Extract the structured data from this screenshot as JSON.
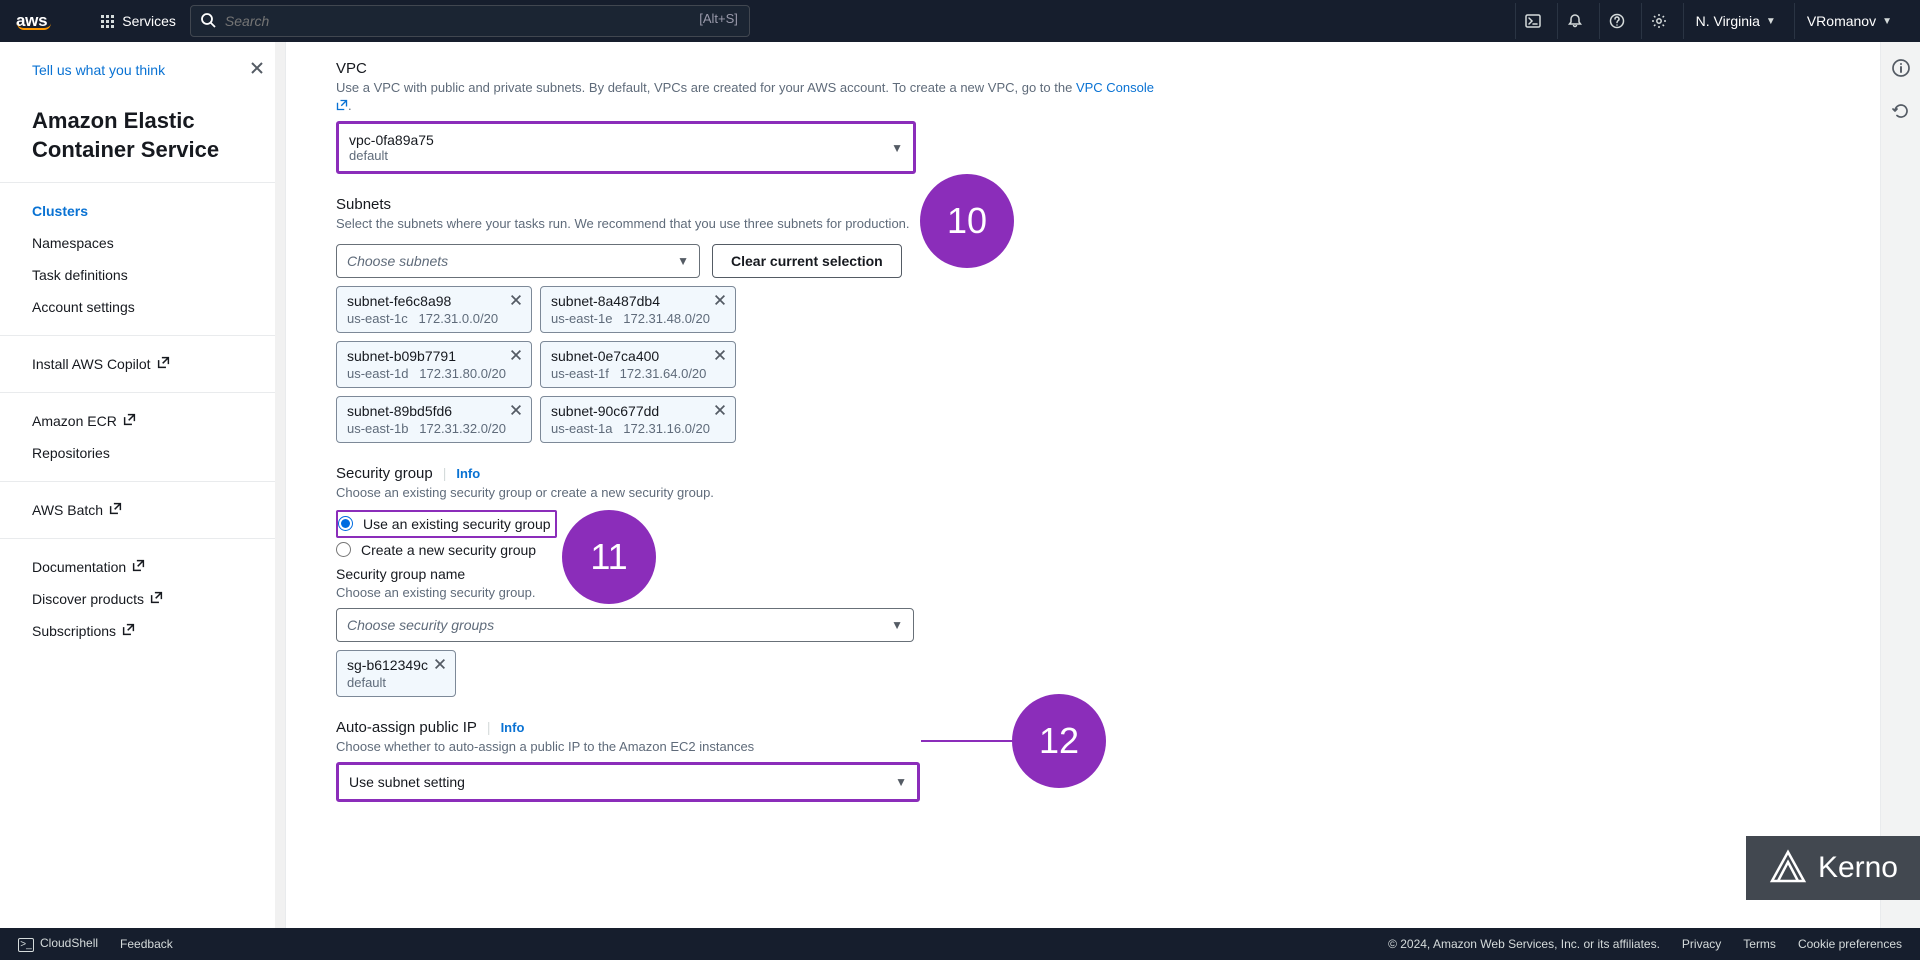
{
  "topnav": {
    "logo_alt": "aws",
    "services_label": "Services",
    "search_placeholder": "Search",
    "search_shortcut": "[Alt+S]",
    "region": "N. Virginia",
    "user": "VRomanov"
  },
  "sidebar": {
    "feedback": "Tell us what you think",
    "title": "Amazon Elastic Container Service",
    "items": [
      {
        "label": "Clusters",
        "active": true
      },
      {
        "label": "Namespaces"
      },
      {
        "label": "Task definitions"
      },
      {
        "label": "Account settings"
      }
    ],
    "links1": [
      {
        "label": "Install AWS Copilot",
        "external": true
      }
    ],
    "links2": [
      {
        "label": "Amazon ECR",
        "external": true
      },
      {
        "label": "Repositories"
      }
    ],
    "links3": [
      {
        "label": "AWS Batch",
        "external": true
      }
    ],
    "links4": [
      {
        "label": "Documentation",
        "external": true
      },
      {
        "label": "Discover products",
        "external": true
      },
      {
        "label": "Subscriptions",
        "external": true
      }
    ]
  },
  "form": {
    "vpc": {
      "label": "VPC",
      "desc": "Use a VPC with public and private subnets. By default, VPCs are created for your AWS account. To create a new VPC, go to the ",
      "link": "VPC Console",
      "value": "vpc-0fa89a75",
      "sub": "default"
    },
    "subnets": {
      "label": "Subnets",
      "desc": "Select the subnets where your tasks run. We recommend that you use three subnets for production.",
      "placeholder": "Choose subnets",
      "clear_label": "Clear current selection",
      "tokens": [
        {
          "id": "subnet-fe6c8a98",
          "az": "us-east-1c",
          "cidr": "172.31.0.0/20"
        },
        {
          "id": "subnet-8a487db4",
          "az": "us-east-1e",
          "cidr": "172.31.48.0/20"
        },
        {
          "id": "subnet-b09b7791",
          "az": "us-east-1d",
          "cidr": "172.31.80.0/20"
        },
        {
          "id": "subnet-0e7ca400",
          "az": "us-east-1f",
          "cidr": "172.31.64.0/20"
        },
        {
          "id": "subnet-89bd5fd6",
          "az": "us-east-1b",
          "cidr": "172.31.32.0/20"
        },
        {
          "id": "subnet-90c677dd",
          "az": "us-east-1a",
          "cidr": "172.31.16.0/20"
        }
      ]
    },
    "sg": {
      "label": "Security group",
      "info": "Info",
      "desc": "Choose an existing security group or create a new security group.",
      "opt_existing": "Use an existing security group",
      "opt_create": "Create a new security group",
      "name_label": "Security group name",
      "name_desc": "Choose an existing security group.",
      "placeholder": "Choose security groups",
      "token": {
        "id": "sg-b612349c",
        "sub": "default"
      }
    },
    "autoip": {
      "label": "Auto-assign public IP",
      "info": "Info",
      "desc": "Choose whether to auto-assign a public IP to the Amazon EC2 instances",
      "value": "Use subnet setting"
    }
  },
  "badges": {
    "b10": "10",
    "b11": "11",
    "b12": "12"
  },
  "footer": {
    "cloudshell": "CloudShell",
    "feedback": "Feedback",
    "copyright": "© 2024, Amazon Web Services, Inc. or its affiliates.",
    "privacy": "Privacy",
    "terms": "Terms",
    "cookies": "Cookie preferences"
  },
  "brand": {
    "kerno": "Kerno"
  }
}
